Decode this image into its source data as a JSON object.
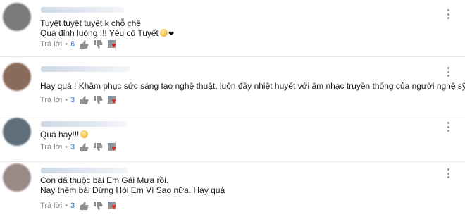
{
  "comments": [
    {
      "lines": [
        "Tuyệt tuyệt tuyệt k chỗ chê",
        "Quá đỉnh luông !!! Yêu cô Tuyết"
      ],
      "reply_label": "Trả lời",
      "separator": "•",
      "like_count": "6",
      "avatar_color": "#7a7a7a",
      "has_emoji": true,
      "has_heart": true
    },
    {
      "lines": [
        "Hay quá ! Khâm phục sức sáng tạo nghệ thuật, luôn đầy nhiệt huyết với âm nhạc truyền thống của người nghệ sỹ lớn"
      ],
      "reply_label": "Trả lời",
      "separator": "•",
      "like_count": "3",
      "avatar_color": "#8a6a5a",
      "has_emoji": false,
      "has_heart": false
    },
    {
      "lines": [
        "Quá hay!!!"
      ],
      "reply_label": "Trả lời",
      "separator": "•",
      "like_count": "3",
      "avatar_color": "#5e6e7a",
      "has_emoji": true,
      "has_heart": false
    },
    {
      "lines": [
        "Con đã thuộc bài Em Gái Mưa rồi.",
        "Nay thêm bài Đừng Hỏi Em Vì Sao nữa. Hay quá"
      ],
      "reply_label": "Trả lời",
      "separator": "•",
      "like_count": "3",
      "avatar_color": "#9a8a86",
      "has_emoji": false,
      "has_heart": false
    }
  ],
  "colors": {
    "like_count": "#2a6fd0",
    "creator_heart": "#e1262d",
    "action_text": "#7a7a7a"
  }
}
